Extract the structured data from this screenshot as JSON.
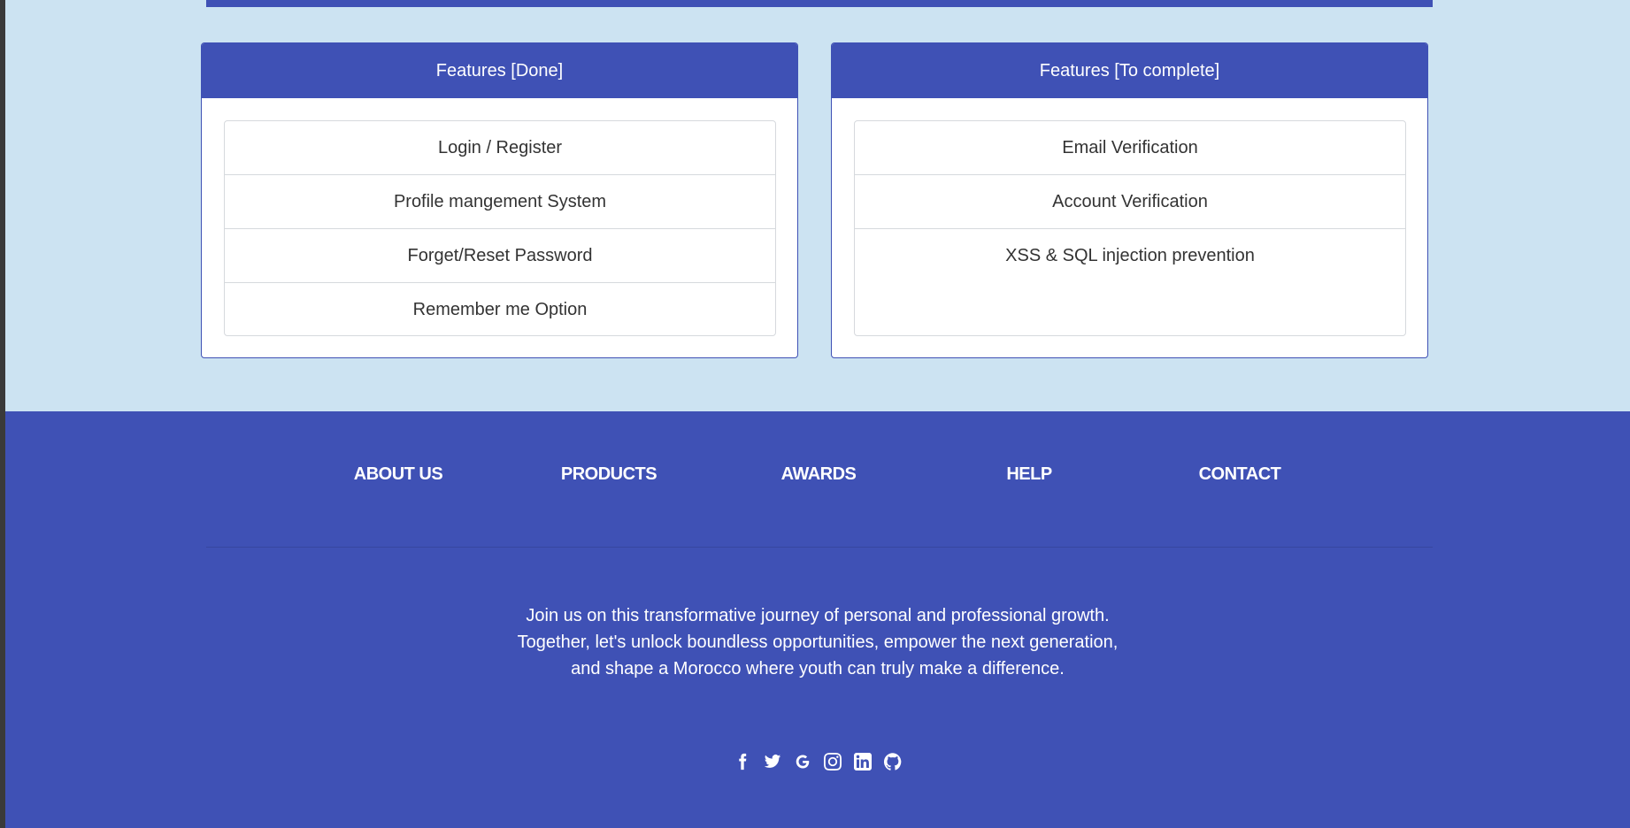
{
  "features_done": {
    "title": "Features [Done]",
    "items": [
      "Login / Register",
      "Profile mangement System",
      "Forget/Reset Password",
      "Remember me Option"
    ]
  },
  "features_todo": {
    "title": "Features [To complete]",
    "items": [
      "Email Verification",
      "Account Verification",
      "XSS & SQL injection prevention"
    ]
  },
  "footer": {
    "nav": [
      "ABOUT US",
      "PRODUCTS",
      "AWARDS",
      "HELP",
      "CONTACT"
    ],
    "tagline": [
      "Join us on this transformative journey of personal and professional growth.",
      "Together, let's unlock boundless opportunities, empower the next generation,",
      "and shape a Morocco where youth can truly make a difference."
    ],
    "social_icons": [
      "facebook-icon",
      "twitter-icon",
      "google-icon",
      "instagram-icon",
      "linkedin-icon",
      "github-icon"
    ]
  },
  "colors": {
    "primary": "#3f51b5",
    "page_background": "#cce3f2",
    "card_background": "#ffffff",
    "text": "#333333"
  }
}
